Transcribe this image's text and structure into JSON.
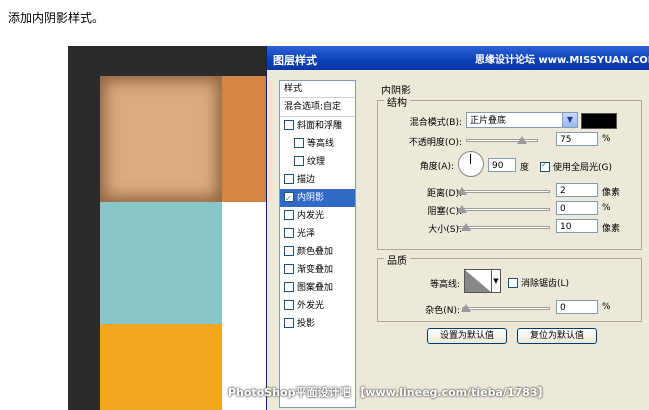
{
  "caption": "添加内阴影样式。",
  "dialog": {
    "title": "图层样式",
    "watermark": "思缘设计论坛 www.MISSYUAN.COM"
  },
  "left_panel": {
    "header": "样式",
    "blend_options": "混合选项:自定",
    "items": [
      {
        "label": "斜面和浮雕",
        "checked": false,
        "sub": false,
        "selected": false
      },
      {
        "label": "等高线",
        "checked": false,
        "sub": true,
        "selected": false
      },
      {
        "label": "纹理",
        "checked": false,
        "sub": true,
        "selected": false
      },
      {
        "label": "描边",
        "checked": false,
        "sub": false,
        "selected": false
      },
      {
        "label": "内阴影",
        "checked": true,
        "sub": false,
        "selected": true
      },
      {
        "label": "内发光",
        "checked": false,
        "sub": false,
        "selected": false
      },
      {
        "label": "光泽",
        "checked": false,
        "sub": false,
        "selected": false
      },
      {
        "label": "颜色叠加",
        "checked": false,
        "sub": false,
        "selected": false
      },
      {
        "label": "渐变叠加",
        "checked": false,
        "sub": false,
        "selected": false
      },
      {
        "label": "图案叠加",
        "checked": false,
        "sub": false,
        "selected": false
      },
      {
        "label": "外发光",
        "checked": false,
        "sub": false,
        "selected": false
      },
      {
        "label": "投影",
        "checked": false,
        "sub": false,
        "selected": false
      }
    ]
  },
  "inner_shadow": {
    "section_title": "内阴影",
    "structure": {
      "group_label": "结构",
      "blend_mode_label": "混合模式(B):",
      "blend_mode_value": "正片叠底",
      "shadow_color": "#000000",
      "opacity_label": "不透明度(O):",
      "opacity_value": "75",
      "opacity_unit": "%",
      "angle_label": "角度(A):",
      "angle_value": "90",
      "angle_unit": "度",
      "global_light_label": "使用全局光(G)",
      "global_light_checked": true,
      "distance_label": "距离(D):",
      "distance_value": "2",
      "distance_unit": "像素",
      "choke_label": "阻塞(C):",
      "choke_value": "0",
      "choke_unit": "%",
      "size_label": "大小(S):",
      "size_value": "10",
      "size_unit": "像素"
    },
    "quality": {
      "group_label": "品质",
      "contour_label": "等高线:",
      "anti_alias_label": "消除锯齿(L)",
      "anti_alias_checked": false,
      "noise_label": "杂色(N):",
      "noise_value": "0",
      "noise_unit": "%"
    },
    "buttons": {
      "set_default": "设置为默认值",
      "reset_default": "复位为默认值"
    }
  },
  "bottom_watermark": "PhotoShop平面设计吧 【www.lineeg.com/tieba/1783】",
  "colors": {
    "swatch_tan": "#dcab7f",
    "swatch_orange": "#d38543",
    "swatch_teal": "#8ac6c8",
    "swatch_yellow": "#f2a51e",
    "selection_blue": "#316ac5"
  }
}
